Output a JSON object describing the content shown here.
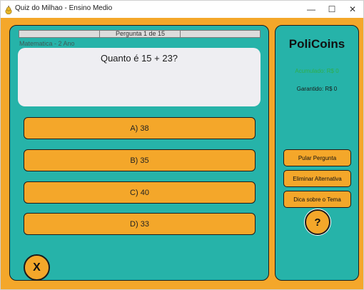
{
  "window": {
    "title": "Quiz do Milhao - Ensino Medio",
    "minimize_glyph": "—",
    "maximize_glyph": "☐",
    "close_glyph": "✕",
    "icon": "pear-app-icon"
  },
  "progress": {
    "label": "Pergunta 1 de 15",
    "current": 1,
    "total": 15
  },
  "subject": "Matematica - 2 Ano",
  "question": {
    "text": "Quanto é 15 + 23?"
  },
  "options": [
    {
      "label": "A) 38"
    },
    {
      "label": "B) 35"
    },
    {
      "label": "C) 40"
    },
    {
      "label": "D) 33"
    }
  ],
  "quit_label": "X",
  "sidebar": {
    "brand": "PoliCoins",
    "accumulated": "Acumulado: R$ 0",
    "guaranteed": "Garantido: R$ 0",
    "aids": [
      {
        "label": "Pular Pergunta"
      },
      {
        "label": "Eliminar Alternativa"
      },
      {
        "label": "Dica sobre o Tema"
      }
    ],
    "help_label": "?"
  },
  "colors": {
    "background": "#f4a72a",
    "panel": "#26b3a9",
    "button": "#f4a72a",
    "accumulated_text": "#2fae4b",
    "question_box": "#eeeef2"
  }
}
